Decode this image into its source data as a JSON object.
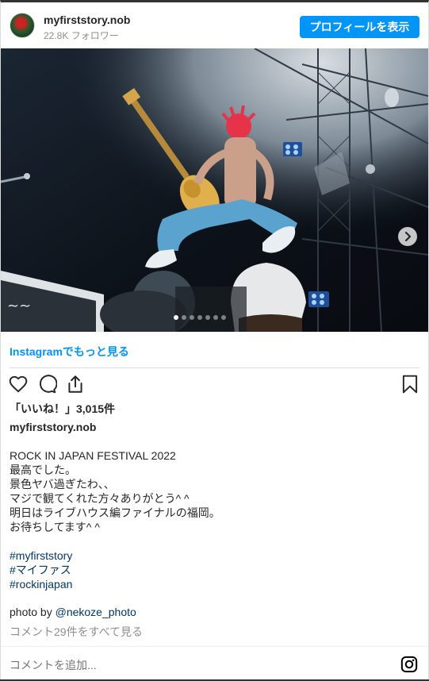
{
  "header": {
    "username": "myfirststory.nob",
    "followers": "22.8K フォロワー",
    "profile_button": "プロフィールを表示"
  },
  "photo": {
    "slide_count": 7,
    "active_slide": 1
  },
  "more_link": "Instagramでもっと見る",
  "actions": {
    "like_icon": "heart-icon",
    "comment_icon": "comment-icon",
    "share_icon": "share-icon",
    "save_icon": "bookmark-icon"
  },
  "likes": "「いいね！」3,015件",
  "caption": {
    "username": "myfirststory.nob",
    "lines": [
      "ROCK IN JAPAN FESTIVAL 2022",
      "最高でした。",
      "景色ヤバ過ぎたわ、、",
      "マジで観てくれた方々ありがとう^ ^",
      "明日はライブハウス編ファイナルの福岡。",
      "お待ちしてます^ ^"
    ],
    "hashtags": [
      "#myfirststory",
      "#マイファス",
      "#rockinjapan"
    ],
    "credit_prefix": "photo by ",
    "credit_mention": "@nekoze_photo"
  },
  "view_comments": "コメント29件をすべて見る",
  "comment_input": {
    "placeholder": "コメントを追加..."
  },
  "colors": {
    "accent": "#0095f6",
    "link_dark": "#00376b",
    "muted": "#8e8e8e"
  }
}
